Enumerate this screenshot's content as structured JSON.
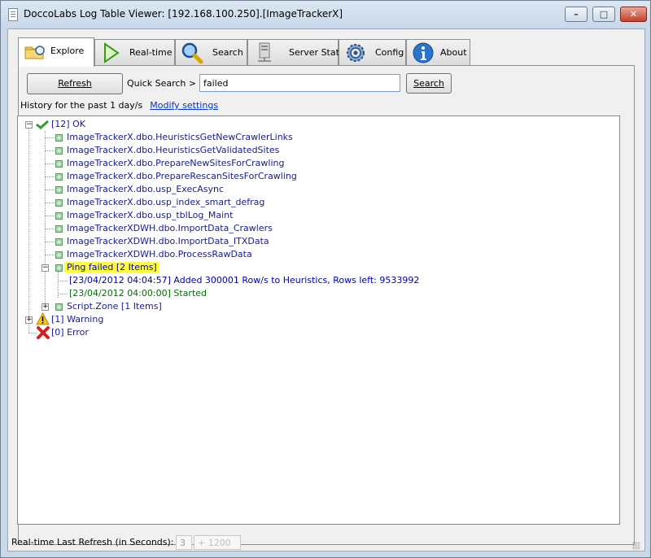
{
  "window": {
    "title": "DoccoLabs Log Table Viewer: [192.168.100.250].[ImageTrackerX]",
    "controls": {
      "minimize": "–",
      "maximize": "□",
      "close": "✕"
    }
  },
  "tabs": [
    {
      "label": "Explore",
      "icon": "folder-search-icon",
      "active": true
    },
    {
      "label": "Real-time",
      "icon": "play-icon"
    },
    {
      "label": "Search",
      "icon": "magnifier-icon"
    },
    {
      "label": "Server Stats",
      "icon": "server-icon"
    },
    {
      "label": "Config",
      "icon": "gear-icon"
    },
    {
      "label": "About",
      "icon": "info-icon"
    }
  ],
  "toolbar": {
    "refresh_label": "Refresh",
    "quick_search_label": "Quick Search >",
    "quick_search_value": "failed",
    "search_label": "Search"
  },
  "history": {
    "text": "History for the past 1 day/s",
    "modify_link": "Modify settings"
  },
  "tree": {
    "ok": {
      "label": "[12] OK",
      "items": [
        "ImageTrackerX.dbo.HeuristicsGetNewCrawlerLinks",
        "ImageTrackerX.dbo.HeuristicsGetValidatedSites",
        "ImageTrackerX.dbo.PrepareNewSitesForCrawling",
        "ImageTrackerX.dbo.PrepareRescanSitesForCrawling",
        "ImageTrackerX.dbo.usp_ExecAsync",
        "ImageTrackerX.dbo.usp_index_smart_defrag",
        "ImageTrackerX.dbo.usp_tblLog_Maint",
        "ImageTrackerXDWH.dbo.ImportData_Crawlers",
        "ImageTrackerXDWH.dbo.ImportData_ITXData",
        "ImageTrackerXDWH.dbo.ProcessRawData"
      ],
      "ping_group": {
        "label": "Ping failed  [2 Items]",
        "entries": [
          "[23/04/2012 04:04:57] Added 300001 Row/s to Heuristics, Rows left: 9533992",
          "[23/04/2012 04:00:00] Started"
        ]
      },
      "script_zone": "Script.Zone [1 Items]"
    },
    "warning": "[1] Warning",
    "error": "[0] Error"
  },
  "statusbar": {
    "label": "Real-time Last Refresh (in Seconds):",
    "value": "3",
    "max": "1200"
  },
  "colors": {
    "tree_text": "#1a1a8c",
    "entry_blue": "#0000aa",
    "entry_green": "#007000",
    "highlight": "#ffff40"
  }
}
